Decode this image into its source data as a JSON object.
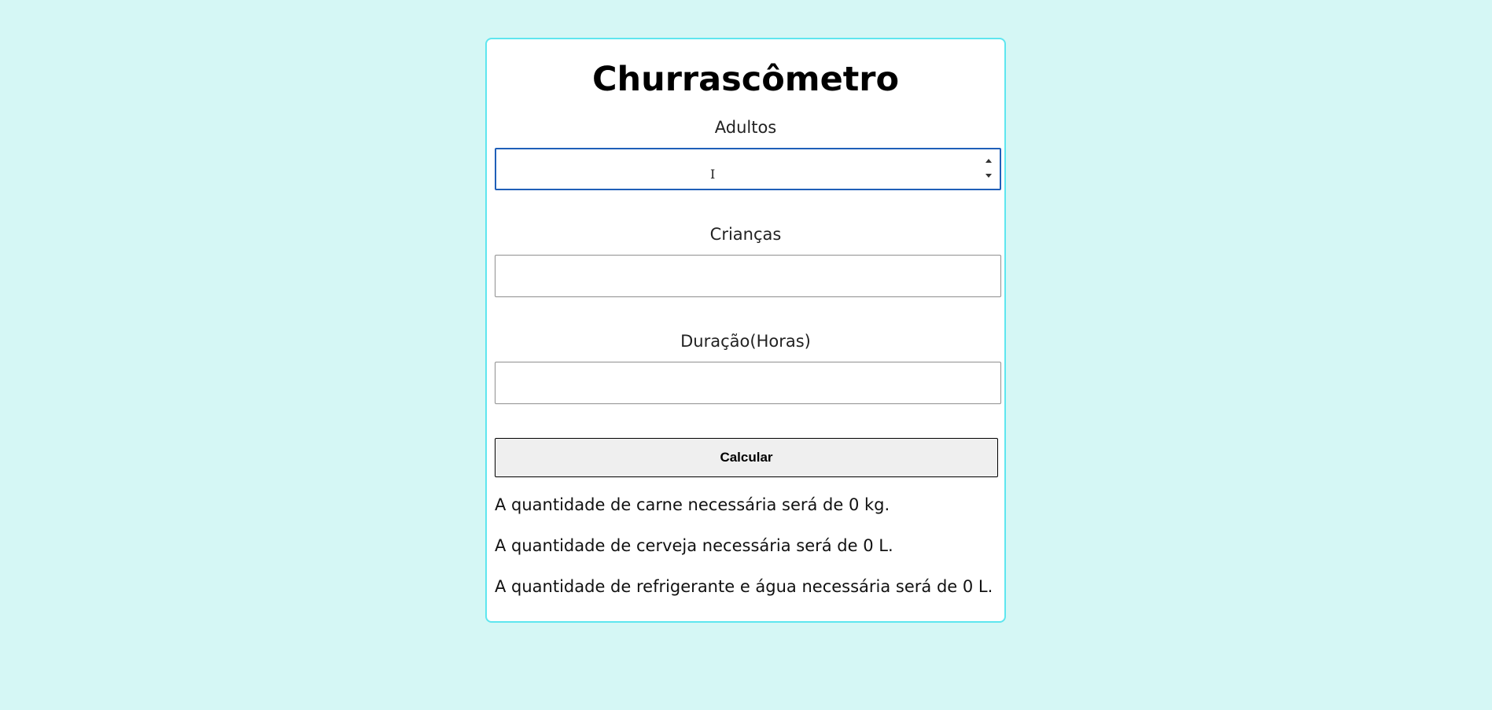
{
  "page": {
    "title": "Churrascômetro",
    "background_color": "#d5f7f5",
    "card_border_color": "#5ee6ef"
  },
  "form": {
    "adults": {
      "label": "Adultos",
      "value": "",
      "type": "number",
      "focused": true
    },
    "children": {
      "label": "Crianças",
      "value": ""
    },
    "duration": {
      "label": "Duração(Horas)",
      "value": ""
    },
    "calculate_label": "Calcular"
  },
  "results": {
    "meat": "A quantidade de carne necessária será de 0 kg.",
    "beer": "A quantidade de cerveja necessária será de 0 L.",
    "drinks": "A quantidade de refrigerante e água necessária será de 0 L."
  },
  "icons": {
    "spinner": "spin-button-arrows",
    "cursor": "text-cursor-icon"
  }
}
